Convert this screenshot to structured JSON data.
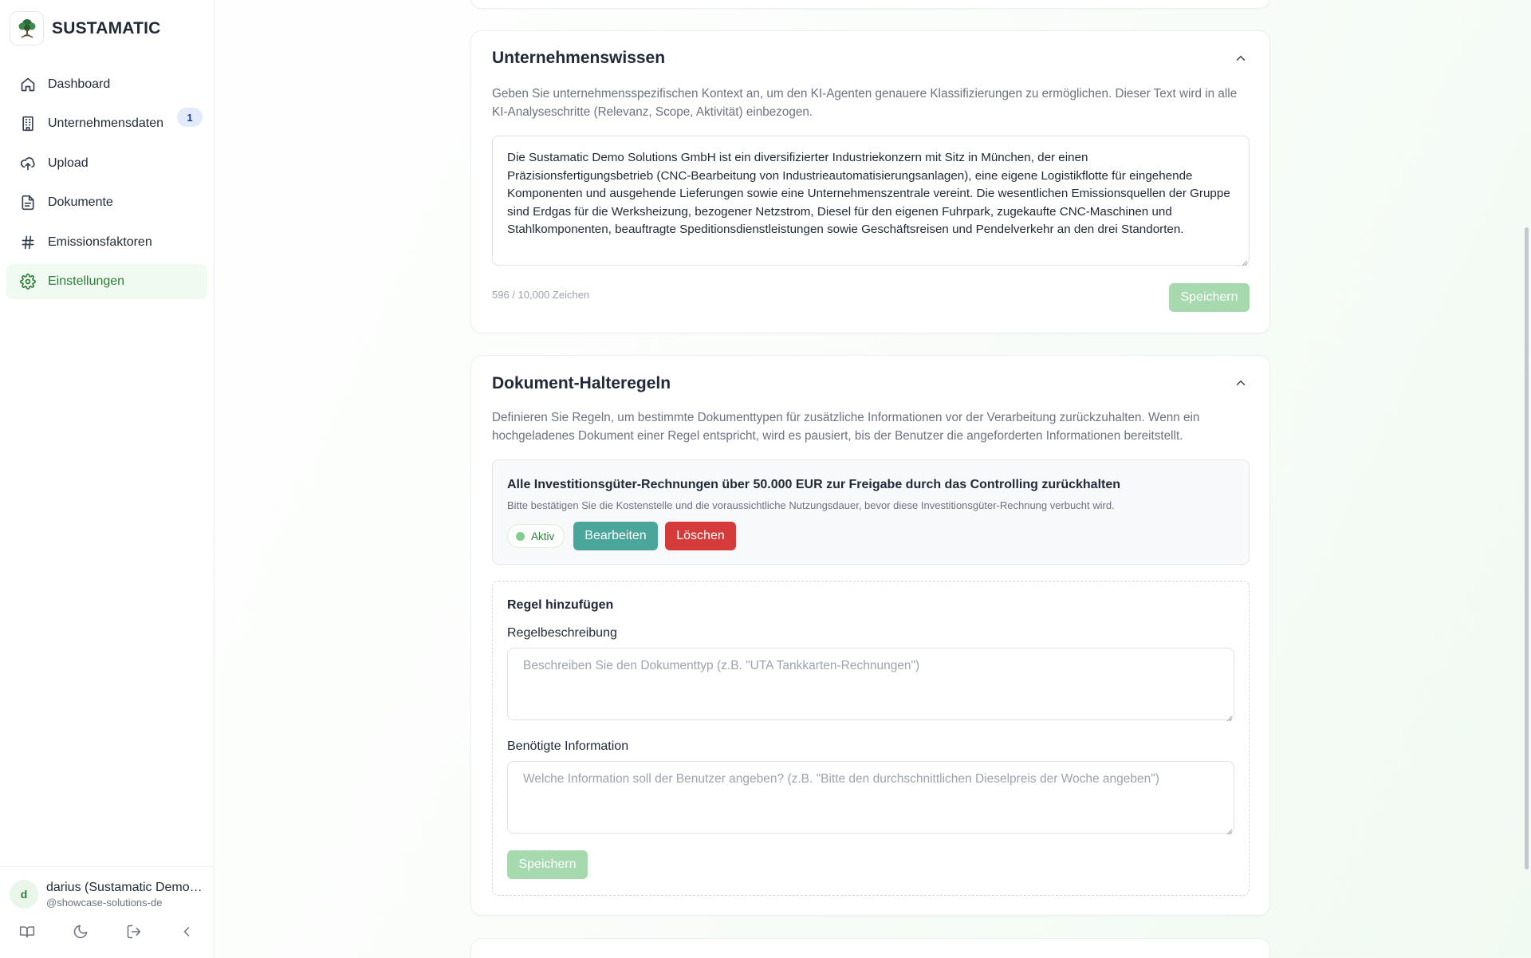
{
  "brand": {
    "name": "SUSTAMATIC"
  },
  "nav": [
    {
      "label": "Dashboard",
      "icon": "home-icon"
    },
    {
      "label": "Unternehmensdaten",
      "icon": "building-icon",
      "badge": "1"
    },
    {
      "label": "Upload",
      "icon": "cloud-upload-icon"
    },
    {
      "label": "Dokumente",
      "icon": "document-icon"
    },
    {
      "label": "Emissionsfaktoren",
      "icon": "hash-icon"
    },
    {
      "label": "Einstellungen",
      "icon": "gear-icon",
      "active": true
    }
  ],
  "user": {
    "initial": "d",
    "name": "darius (Sustamatic Demo Solutions GmbH)",
    "handle": "@showcase-solutions-de"
  },
  "company_knowledge": {
    "title": "Unternehmenswissen",
    "description": "Geben Sie unternehmensspezifischen Kontext an, um den KI-Agenten genauere Klassifizierungen zu ermöglichen. Dieser Text wird in alle KI-Analyseschritte (Relevanz, Scope, Aktivität) einbezogen.",
    "text": "Die Sustamatic Demo Solutions GmbH ist ein diversifizierter Industriekonzern mit Sitz in München, der einen Präzisionsfertigungsbetrieb (CNC-Bearbeitung von Industrieautomatisierungsanlagen), eine eigene Logistikflotte für eingehende Komponenten und ausgehende Lieferungen sowie eine Unternehmenszentrale vereint. Die wesentlichen Emissionsquellen der Gruppe sind Erdgas für die Werksheizung, bezogener Netzstrom, Diesel für den eigenen Fuhrpark, zugekaufte CNC-Maschinen und Stahlkomponenten, beauftragte Speditionsdienstleistungen sowie Geschäftsreisen und Pendelverkehr an den drei Standorten.",
    "counter": "596 / 10,000 Zeichen",
    "save_label": "Speichern"
  },
  "hold_rules": {
    "title": "Dokument-Halteregeln",
    "description": "Definieren Sie Regeln, um bestimmte Dokumenttypen für zusätzliche Informationen vor der Verarbeitung zurückzuhalten. Wenn ein hochgeladenes Dokument einer Regel entspricht, wird es pausiert, bis der Benutzer die angeforderten Informationen bereitstellt.",
    "rule": {
      "title": "Alle Investitionsgüter-Rechnungen über 50.000 EUR zur Freigabe durch das Controlling zurückhalten",
      "subtitle": "Bitte bestätigen Sie die Kostenstelle und die voraussichtliche Nutzungsdauer, bevor diese Investitionsgüter-Rechnung verbucht wird.",
      "status": "Aktiv",
      "edit_label": "Bearbeiten",
      "delete_label": "Löschen"
    },
    "add": {
      "title": "Regel hinzufügen",
      "description_label": "Regelbeschreibung",
      "description_placeholder": "Beschreiben Sie den Dokumenttyp (z.B. \"UTA Tankkarten-Rechnungen\")",
      "info_label": "Benötigte Information",
      "info_placeholder": "Welche Information soll der Benutzer angeben? (z.B. \"Bitte den durchschnittlichen Dieselpreis der Woche angeben\")",
      "save_label": "Speichern"
    }
  }
}
